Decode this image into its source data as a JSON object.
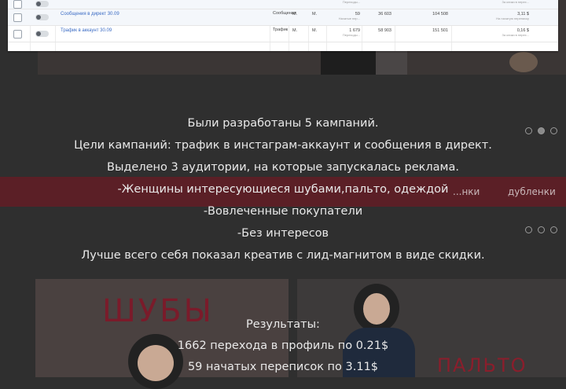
{
  "ads_table": {
    "rows": [
      {
        "name": "",
        "objective": "",
        "b1": "",
        "b2": "",
        "results": "",
        "results_sub": "Переходы...",
        "reach": "",
        "impressions": "",
        "cost": "",
        "cost_sub": "За клики в перех..."
      },
      {
        "name": "Сообщения в директ 30.09",
        "objective": "Сообщения",
        "b1": "М.",
        "b2": "М.",
        "results": "59",
        "results_sub": "Начатые пер...",
        "reach": "36 603",
        "impressions": "104 508",
        "cost": "3,11 $",
        "cost_sub": "На начатую переписку"
      },
      {
        "name": "Трафик в аккаунт 30.09",
        "objective": "Трафик",
        "b1": "М.",
        "b2": "М.",
        "results": "1 679",
        "results_sub": "Переходы...",
        "reach": "58 903",
        "impressions": "151 501",
        "cost": "0,16 $",
        "cost_sub": "За клики в перех..."
      }
    ]
  },
  "background": {
    "nav_items": [
      "...нки",
      "дубленки"
    ],
    "banner_left_text": "ШУБЫ",
    "banner_right_text": "ПАЛЬТО"
  },
  "overlay_text": {
    "lines": [
      "Были разработаны 5 кампаний.",
      "Цели кампаний: трафик в инстаграм-аккаунт и сообщения в директ.",
      "Выделено 3 аудитории, на которые запускалась реклама.",
      "-Женщины интересующиеся шубами,пальто, одеждой",
      "-Вовлеченные покупатели",
      "-Без интересов",
      "Лучше всего себя показал креатив с лид-магнитом в виде скидки."
    ],
    "results_lines": [
      "Результаты:",
      "1662 перехода в профиль по 0.21$",
      "59 начатых переписок по 3.11$"
    ]
  },
  "colors": {
    "overlay_bg": "#2f2f2f",
    "band": "#5b1f26",
    "brand_red": "#7a1b2a",
    "link_blue": "#3a6bc4"
  }
}
